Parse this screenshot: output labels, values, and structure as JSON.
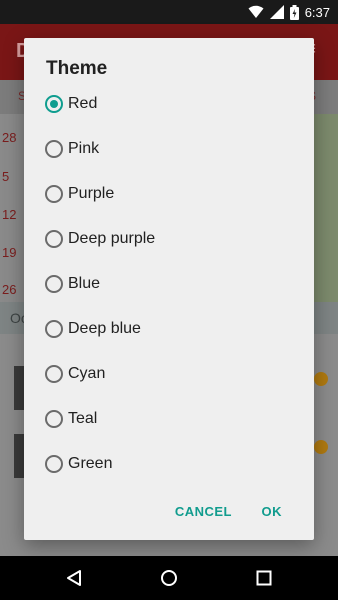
{
  "status_bar": {
    "time": "6:37"
  },
  "dialog": {
    "title": "Theme",
    "selected": "Red",
    "options": [
      "Red",
      "Pink",
      "Purple",
      "Deep purple",
      "Blue",
      "Deep blue",
      "Cyan",
      "Teal",
      "Green"
    ],
    "cancel_label": "CANCEL",
    "ok_label": "OK",
    "accent_color": "#0f9d8f"
  },
  "background": {
    "toolbar_color": "#c62828",
    "calendar_dates": [
      "28",
      "5",
      "12",
      "19",
      "26"
    ],
    "icons": [
      "wifi-icon",
      "signal-icon",
      "battery-icon",
      "nav-back-icon",
      "nav-home-icon",
      "nav-recents-icon"
    ]
  }
}
